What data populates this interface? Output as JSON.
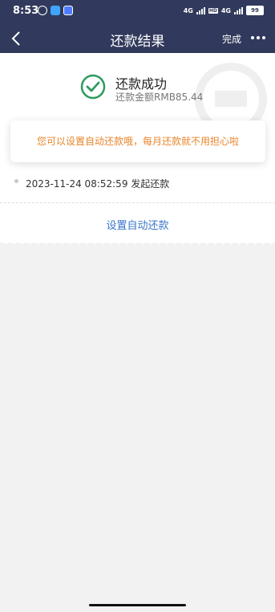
{
  "status_bar": {
    "time": "8:53",
    "network1": "4G",
    "hd": "HD",
    "network2": "4G",
    "battery": "99"
  },
  "nav": {
    "title": "还款结果",
    "done_label": "完成"
  },
  "result": {
    "title": "还款成功",
    "amount": "还款金额RMB85.44"
  },
  "tip": "您可以设置自动还款哦，每月还款就不用担心啦",
  "timeline": {
    "entry": "2023-11-24 08:52:59 发起还款"
  },
  "link": {
    "label": "设置自动还款"
  },
  "colors": {
    "header_bg": "#313a5c",
    "success": "#2e9a5e",
    "tip_text": "#e8852b",
    "link": "#3a76c9",
    "page_bg": "#f2f2f2"
  },
  "icons": [
    "alarm-icon",
    "app-icon",
    "signal-icon",
    "battery-icon",
    "back-arrow-icon",
    "more-icon",
    "check-circle-icon",
    "bank-logo-watermark"
  ]
}
